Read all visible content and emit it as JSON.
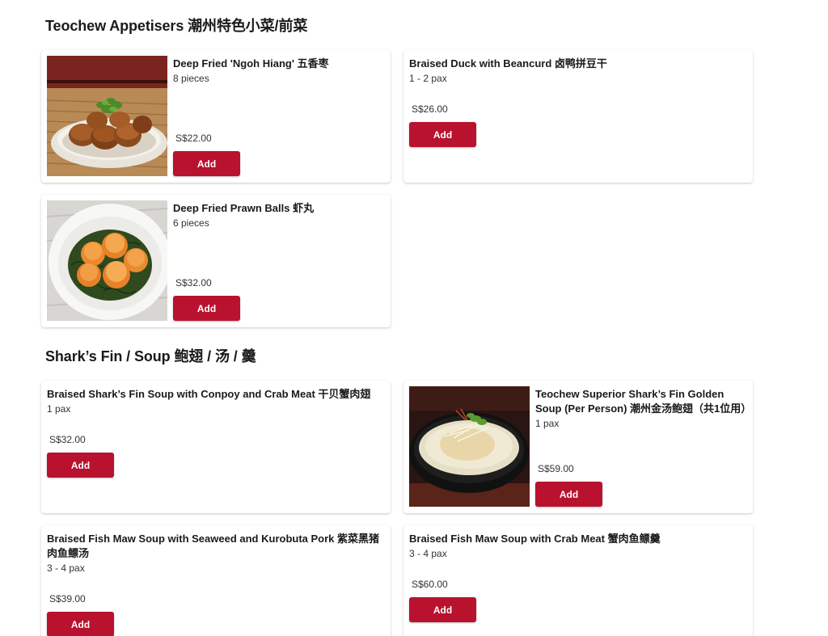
{
  "sections": [
    {
      "title": "Teochew Appetisers 潮州特色小菜/前菜"
    },
    {
      "title": "Shark’s Fin / Soup 鲍翅 / 汤 / 羹"
    }
  ],
  "items": [
    {
      "name": "Deep Fried 'Ngoh Hiang' 五香枣",
      "desc": "8 pieces",
      "price": "S$22.00",
      "button": "Add",
      "image": "ngoh-hiang-photo"
    },
    {
      "name": "Braised Duck with Beancurd 卤鸭拼豆干",
      "desc": "1 - 2 pax",
      "price": "S$26.00",
      "button": "Add"
    },
    {
      "name": "Deep Fried Prawn Balls 虾丸",
      "desc": "6 pieces",
      "price": "S$32.00",
      "button": "Add",
      "image": "prawn-balls-photo"
    },
    {
      "name": "Braised Shark’s Fin Soup with Conpoy and Crab Meat 干贝蟹肉翅",
      "desc": "1 pax",
      "price": "S$32.00",
      "button": "Add"
    },
    {
      "name": "Teochew Superior Shark’s Fin Golden Soup (Per Person) 潮州金汤鲍翅（共1位用）",
      "desc": "1 pax",
      "price": "S$59.00",
      "button": "Add",
      "image": "golden-soup-photo"
    },
    {
      "name": "Braised Fish Maw Soup with Seaweed and Kurobuta Pork 紫菜黑猪肉鱼鳔汤",
      "desc": "3 - 4 pax",
      "price": "S$39.00",
      "button": "Add"
    },
    {
      "name": "Braised Fish Maw Soup with Crab Meat 蟹肉鱼鳔羹",
      "desc": "3 - 4 pax",
      "price": "S$60.00",
      "button": "Add"
    }
  ],
  "colors": {
    "accent": "#b8122e",
    "card_bg": "#ffffff",
    "text": "#1a1a1a"
  }
}
